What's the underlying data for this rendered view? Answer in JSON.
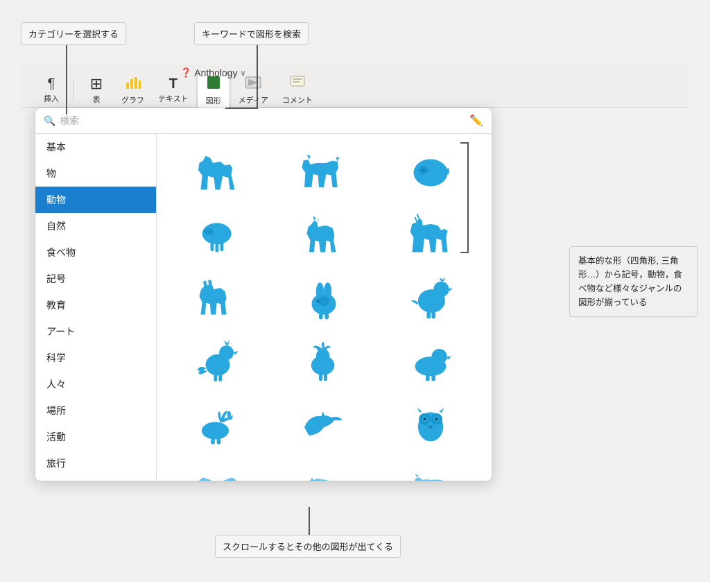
{
  "annotations": {
    "category_label": "カテゴリーを選択する",
    "keyword_label": "キーワードで図形を検索",
    "scroll_label": "スクロールするとその他の図形が出てくる",
    "callout_text": "基本的な形（四角形, 三角形…）から記号，動物，食べ物など様々なジャンルの図形が揃っている"
  },
  "app_title": "Anthology",
  "search": {
    "placeholder": "検索"
  },
  "toolbar": {
    "insert_label": "挿入",
    "table_label": "表",
    "graph_label": "グラフ",
    "text_label": "テキスト",
    "shape_label": "図形",
    "media_label": "メディア",
    "comment_label": "コメント"
  },
  "categories": [
    {
      "id": "kihon",
      "label": "基本",
      "selected": false
    },
    {
      "id": "mono",
      "label": "物",
      "selected": false
    },
    {
      "id": "dobutsu",
      "label": "動物",
      "selected": true
    },
    {
      "id": "shizen",
      "label": "自然",
      "selected": false
    },
    {
      "id": "tabemono",
      "label": "食べ物",
      "selected": false
    },
    {
      "id": "kigo",
      "label": "記号",
      "selected": false
    },
    {
      "id": "kyoiku",
      "label": "教育",
      "selected": false
    },
    {
      "id": "art",
      "label": "アート",
      "selected": false
    },
    {
      "id": "kagaku",
      "label": "科学",
      "selected": false
    },
    {
      "id": "hitobito",
      "label": "人々",
      "selected": false
    },
    {
      "id": "basho",
      "label": "場所",
      "selected": false
    },
    {
      "id": "katsudo",
      "label": "活動",
      "selected": false
    },
    {
      "id": "other",
      "label": "旅行",
      "selected": false
    }
  ]
}
